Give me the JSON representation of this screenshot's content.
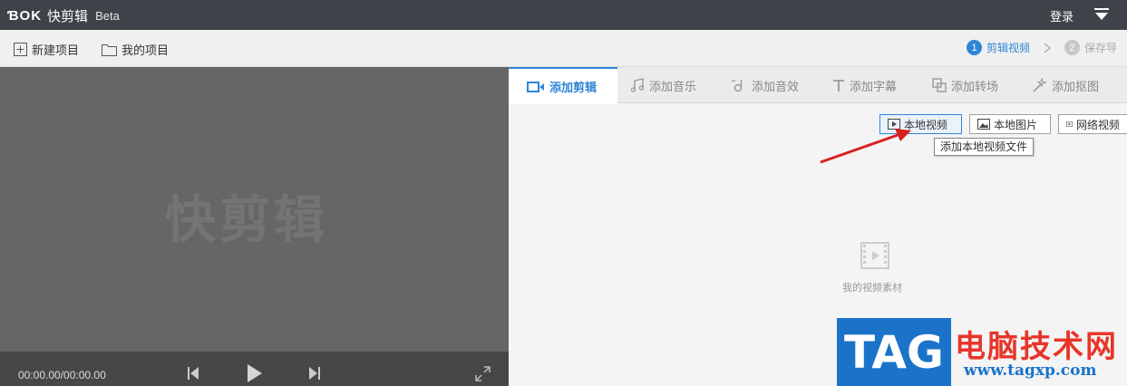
{
  "window": {
    "logo_mark": "ƁOK",
    "app_name": "快剪辑",
    "beta": "Beta",
    "login": "登录"
  },
  "toolbar": {
    "new_project": "新建项目",
    "my_projects": "我的项目"
  },
  "steps": [
    {
      "num": "1",
      "label": "剪辑视频",
      "active": true
    },
    {
      "num": "2",
      "label": "保存导",
      "active": false
    }
  ],
  "preview": {
    "watermark": "快剪辑",
    "timecode": "00:00.00/00:00.00"
  },
  "tabs": [
    {
      "label": "添加剪辑",
      "icon": "video-camera-icon"
    },
    {
      "label": "添加音乐",
      "icon": "music-note-icon"
    },
    {
      "label": "添加音效",
      "icon": "sound-effect-icon"
    },
    {
      "label": "添加字幕",
      "icon": "text-t-icon"
    },
    {
      "label": "添加转场",
      "icon": "transition-icon"
    },
    {
      "label": "添加抠图",
      "icon": "cutout-icon"
    }
  ],
  "sources": {
    "local_video": "本地视频",
    "local_image": "本地图片",
    "web_video": "网络视频",
    "tooltip": "添加本地视频文件"
  },
  "empty": {
    "label": "我的视频素材"
  },
  "watermark_badge": {
    "tag": "TAG",
    "site_name": "电脑技术网",
    "url": "www.tagxp.com"
  },
  "colors": {
    "accent": "#2f86d6",
    "titlebar": "#3f4349",
    "preview_bg": "#666666",
    "annotation_arrow": "#d9201f"
  }
}
